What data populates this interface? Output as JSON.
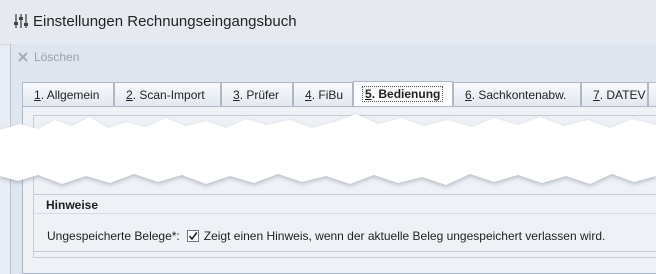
{
  "window": {
    "title": "Einstellungen Rechnungseingangsbuch",
    "title_icon": "settings-sliders-icon"
  },
  "toolbar": {
    "delete_label": "Löschen",
    "delete_icon": "close-x-icon",
    "delete_enabled": false
  },
  "tabs": [
    {
      "key": "1",
      "label": "Allgemein",
      "active": false
    },
    {
      "key": "2",
      "label": "Scan-Import",
      "active": false
    },
    {
      "key": "3",
      "label": "Prüfer",
      "active": false
    },
    {
      "key": "4",
      "label": "FiBu",
      "active": false
    },
    {
      "key": "5",
      "label": "Bedienung",
      "active": true
    },
    {
      "key": "6",
      "label": "Sachkontenabw.",
      "active": false
    },
    {
      "key": "7",
      "label": "DATEV",
      "active": false
    }
  ],
  "hinweise": {
    "title": "Hinweise",
    "row_label": "Ungespeicherte Belege*:",
    "checkbox_checked": true,
    "checkbox_text": "Zeigt einen Hinweis, wenn der aktuelle Beleg ungespeichert verlassen wird."
  },
  "colors": {
    "accent_border": "#aeb8c6",
    "panel_bg": "#eef1f6",
    "frame_bg": "#dfe5ee"
  }
}
